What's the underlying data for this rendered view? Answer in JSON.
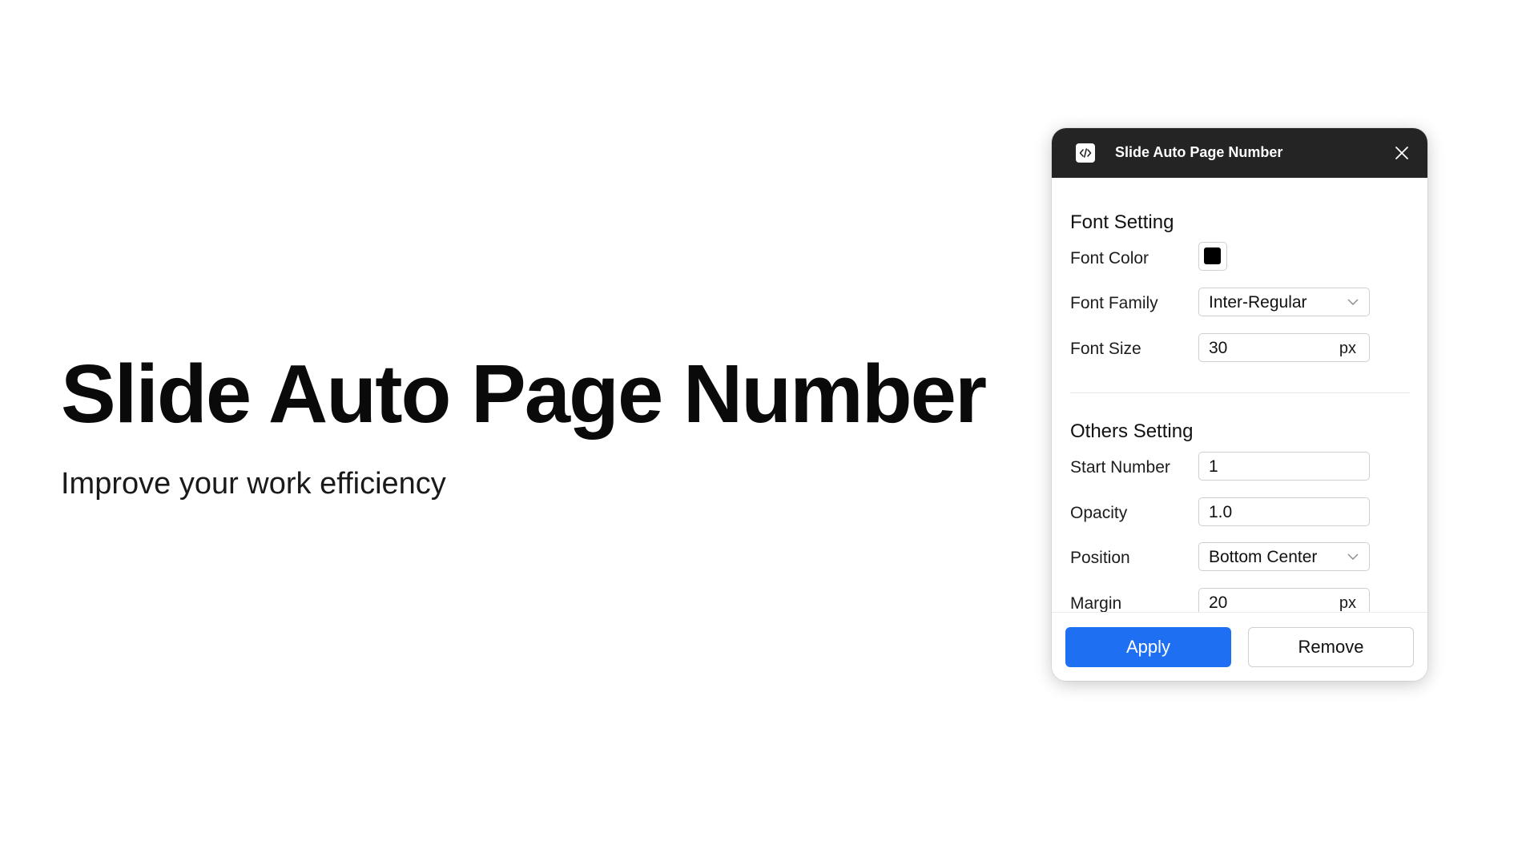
{
  "hero": {
    "title": "Slide Auto Page Number",
    "subtitle": "Improve your work efficiency"
  },
  "panel": {
    "title": "Slide Auto Page Number",
    "app_icon": "code-icon",
    "close_icon": "close-icon",
    "font_section": {
      "heading": "Font Setting",
      "font_color": {
        "label": "Font Color",
        "value": "#000000"
      },
      "font_family": {
        "label": "Font Family",
        "value": "Inter-Regular",
        "icon": "chevron-down-icon"
      },
      "font_size": {
        "label": "Font Size",
        "value": "30",
        "unit": "px"
      }
    },
    "others_section": {
      "heading": "Others Setting",
      "start_number": {
        "label": "Start Number",
        "value": "1"
      },
      "opacity": {
        "label": "Opacity",
        "value": "1.0"
      },
      "position": {
        "label": "Position",
        "value": "Bottom Center",
        "icon": "chevron-down-icon"
      },
      "margin": {
        "label": "Margin",
        "value": "20",
        "unit": "px"
      }
    },
    "buttons": {
      "apply": "Apply",
      "remove": "Remove"
    },
    "colors": {
      "titlebar": "#242424",
      "accent": "#1f6ff2"
    }
  }
}
